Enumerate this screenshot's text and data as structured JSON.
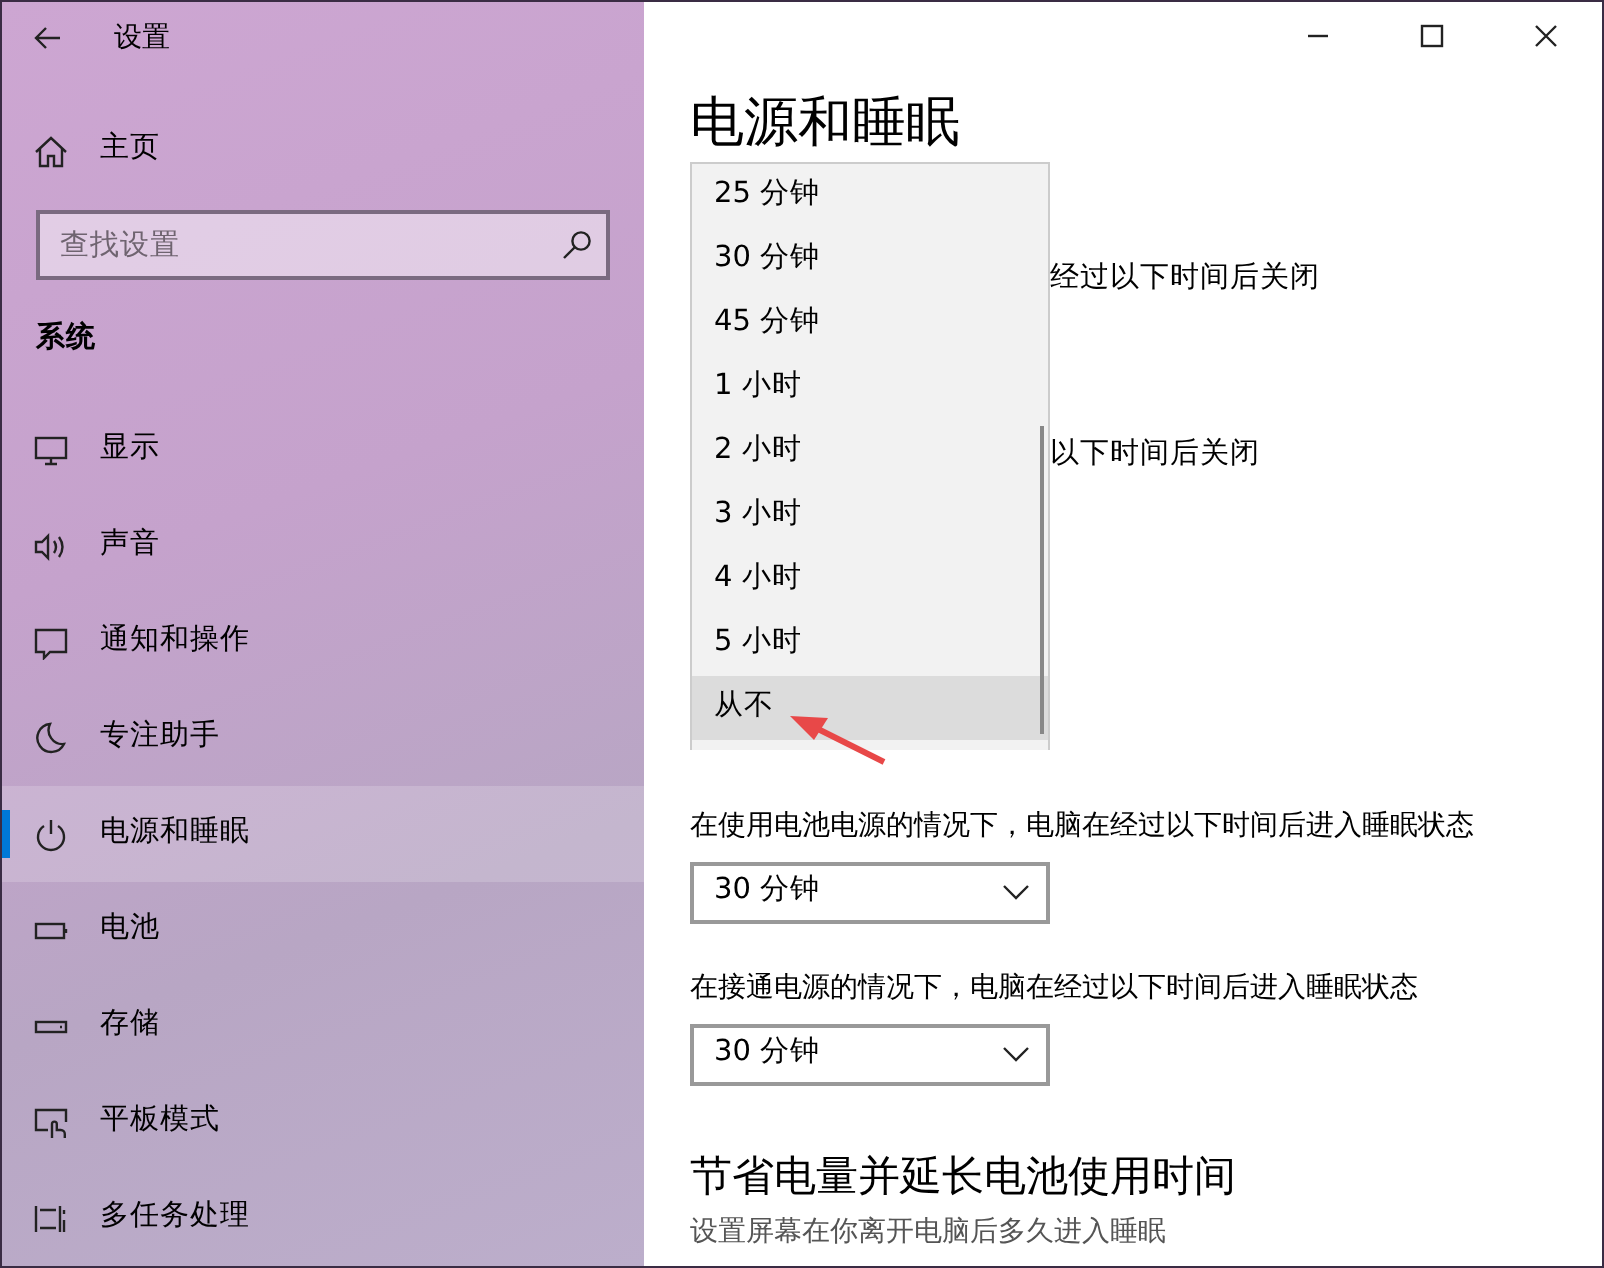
{
  "window": {
    "title": "设置"
  },
  "sidebar": {
    "home": "主页",
    "search": {
      "placeholder": "查找设置"
    },
    "section": "系统",
    "items": [
      {
        "label": "显示",
        "kind": "display",
        "selected": false
      },
      {
        "label": "声音",
        "kind": "sound",
        "selected": false
      },
      {
        "label": "通知和操作",
        "kind": "notifications",
        "selected": false
      },
      {
        "label": "专注助手",
        "kind": "focus",
        "selected": false
      },
      {
        "label": "电源和睡眠",
        "kind": "power",
        "selected": true
      },
      {
        "label": "电池",
        "kind": "battery",
        "selected": false
      },
      {
        "label": "存储",
        "kind": "storage",
        "selected": false
      },
      {
        "label": "平板模式",
        "kind": "tablet",
        "selected": false
      },
      {
        "label": "多任务处理",
        "kind": "multitask",
        "selected": false
      }
    ]
  },
  "main": {
    "heading": "电源和睡眠",
    "partial_labels": [
      "经过以下时间后关闭",
      "以下时间后关闭"
    ],
    "dropdown_list": {
      "options": [
        {
          "label": "25 分钟",
          "selected": false
        },
        {
          "label": "30 分钟",
          "selected": false
        },
        {
          "label": "45 分钟",
          "selected": false
        },
        {
          "label": "1 小时",
          "selected": false
        },
        {
          "label": "2 小时",
          "selected": false
        },
        {
          "label": "3 小时",
          "selected": false
        },
        {
          "label": "4 小时",
          "selected": false
        },
        {
          "label": "5 小时",
          "selected": false
        },
        {
          "label": "从不",
          "selected": true
        }
      ]
    },
    "sleep_settings": [
      {
        "label": "在使用电池电源的情况下，电脑在经过以下时间后进入睡眠状态",
        "value": "30 分钟"
      },
      {
        "label": "在接通电源的情况下，电脑在经过以下时间后进入睡眠状态",
        "value": "30 分钟"
      }
    ],
    "section": {
      "heading": "节省电量并延长电池使用时间",
      "text": "设置屏幕在你离开电脑后多久进入睡眠"
    }
  }
}
